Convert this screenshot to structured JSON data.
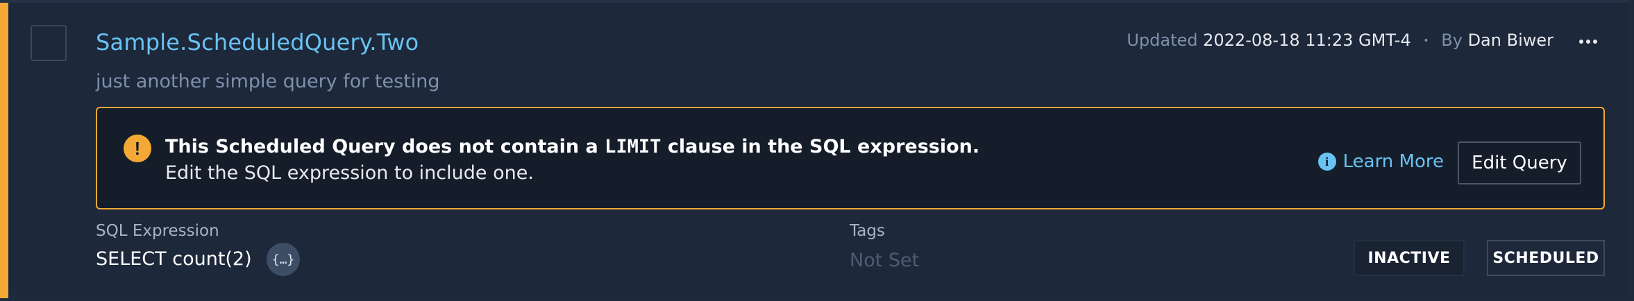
{
  "query": {
    "name": "Sample.ScheduledQuery.Two",
    "description": "just another simple query for testing"
  },
  "meta": {
    "updated_label": "Updated",
    "updated_value": "2022-08-18 11:23 GMT-4",
    "separator": "•",
    "by_label": "By",
    "by_value": "Dan Biwer"
  },
  "warning": {
    "text_before": "This Scheduled Query does not contain a ",
    "code": "LIMIT",
    "text_after": " clause in the SQL expression.",
    "line2": "Edit the SQL expression to include one.",
    "learn_more": "Learn More",
    "edit_button": "Edit Query",
    "icon_glyph": "!",
    "info_glyph": "i"
  },
  "details": {
    "sql_label": "SQL Expression",
    "sql_value": "SELECT count(2)",
    "code_glyph": "{…}",
    "tags_label": "Tags",
    "tags_value": "Not Set"
  },
  "badges": {
    "status": "INACTIVE",
    "type": "SCHEDULED"
  },
  "colors": {
    "accent": "#f3a934",
    "link": "#69c3f2",
    "background": "#1d283a"
  },
  "icons": [
    "warning-icon",
    "info-icon",
    "code-braces-icon",
    "more-horizontal-icon"
  ]
}
